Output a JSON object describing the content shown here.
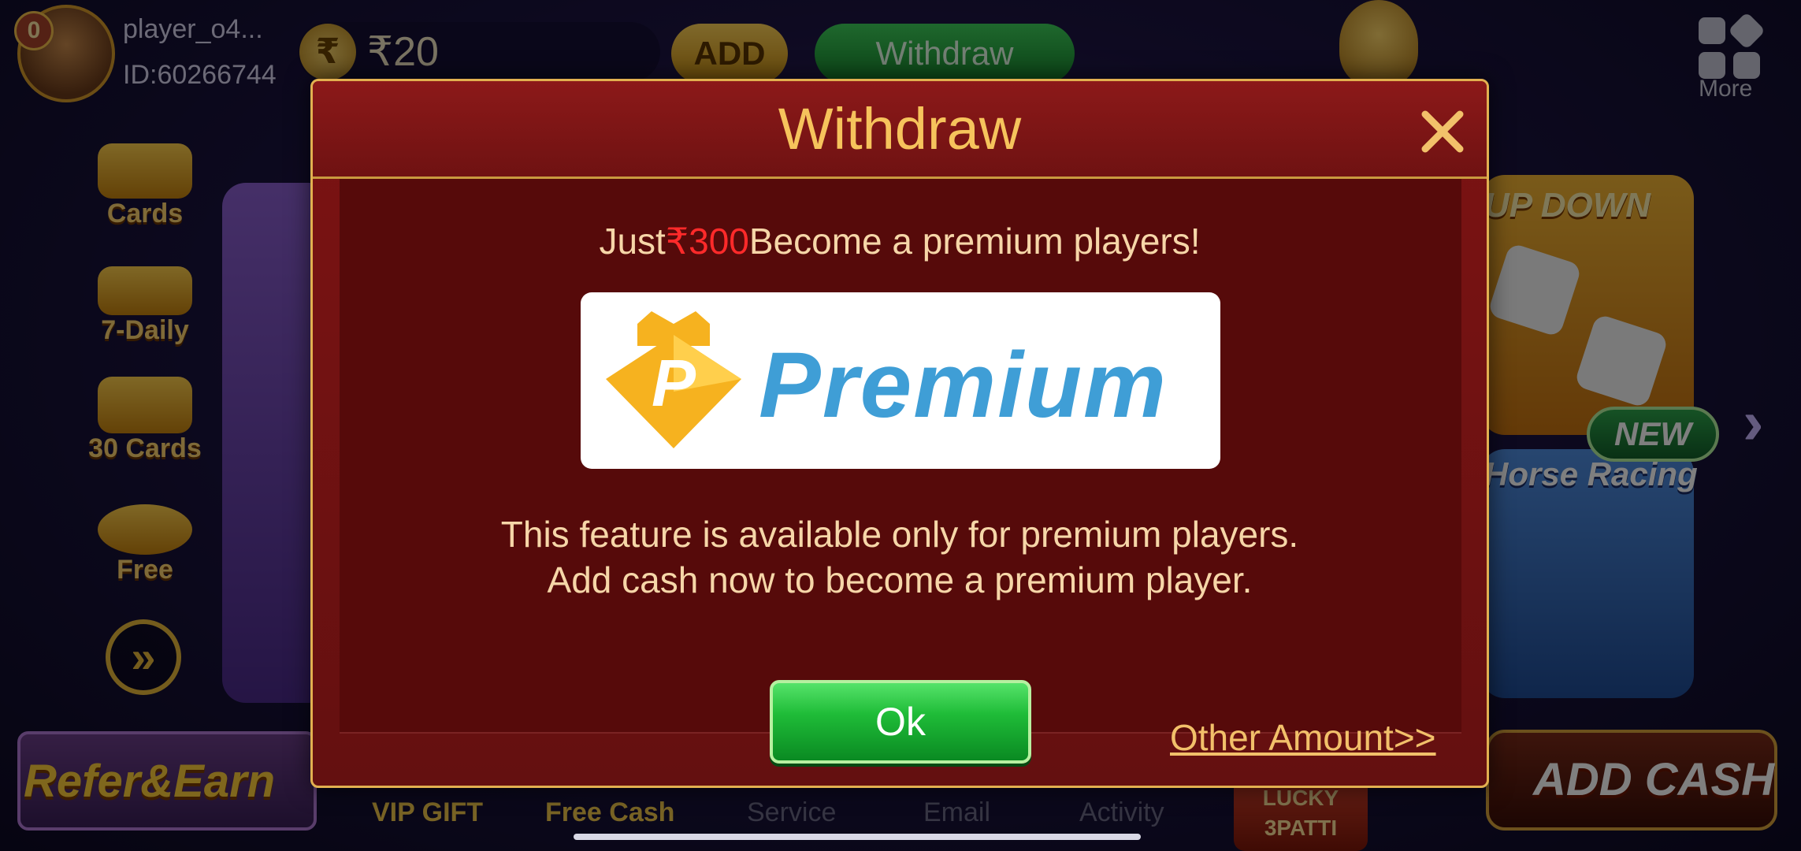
{
  "player": {
    "vip_level": "0",
    "name": "player_o4...",
    "id": "ID:60266744"
  },
  "wallet": {
    "currency_icon": "₹",
    "balance": "₹20",
    "add_label": "ADD",
    "withdraw_label": "Withdraw"
  },
  "top_right": {
    "more_label": "More"
  },
  "left_menu": [
    {
      "label": "Cards",
      "icon": "cards-icon"
    },
    {
      "label": "7-Daily",
      "icon": "calendar-icon"
    },
    {
      "label": "30 Cards",
      "icon": "cards-stack-icon"
    },
    {
      "label": "Free",
      "icon": "coins-icon"
    }
  ],
  "left_arrow_glyph": "»",
  "refer_banner": "Refer&Earn",
  "right_cards": {
    "top_title": "UP DOWN",
    "new_badge": "NEW",
    "bottom_title": "Horse Racing",
    "chevron": "›"
  },
  "add_cash_banner": "ADD CASH",
  "bottom_nav": [
    {
      "label": "VIP GIFT",
      "style": "gold"
    },
    {
      "label": "Free Cash",
      "style": "gold"
    },
    {
      "label": "Service",
      "style": "grey"
    },
    {
      "label": "Email",
      "style": "grey"
    },
    {
      "label": "Activity",
      "style": "grey"
    }
  ],
  "lucky_badge": {
    "line1": "LUCKY",
    "line2": "3PATTI"
  },
  "modal": {
    "title": "Withdraw",
    "close_glyph": "✕",
    "promo_prefix": "Just",
    "promo_amount": "₹300",
    "promo_suffix": "Become a premium players!",
    "premium_logo_letter": "P",
    "premium_word": "Premium",
    "info_line_1": "This feature is available only for premium players.",
    "info_line_2": "Add cash now to become a premium player.",
    "ok_label": "Ok",
    "other_amount_label": "Other Amount>>"
  },
  "colors": {
    "modal_bg": "#7c1313",
    "modal_border": "#e2b050",
    "title": "#f6c35c",
    "promo_amount": "#ff2a2a",
    "body_text": "#f6d6a8",
    "ok_button": "#1fbc38",
    "premium_blue": "#3f9ed6",
    "premium_gold": "#f6b21f"
  }
}
